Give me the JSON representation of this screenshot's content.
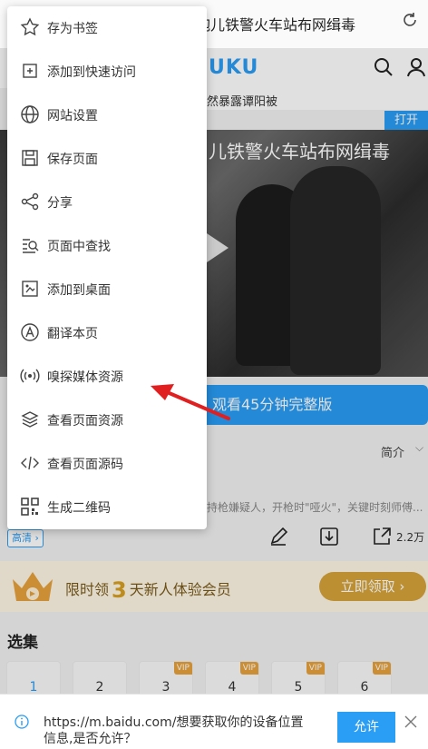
{
  "browser": {
    "page_title": "老炮儿铁警火车站布网缉毒",
    "refresh_icon": "refresh-icon"
  },
  "site": {
    "logo": "UKU",
    "marquee": "然暴露谭阳被",
    "open_label": "打开",
    "video_title": "儿铁警火车站布网缉毒",
    "watch_label": "观看45分钟完整版",
    "intro_label": "简介",
    "description": "持枪嫌疑人，开枪时\"哑火\"，关键时刻师傅...",
    "hd_label": "高清",
    "share_count": "2.2万",
    "vip_text_pre": "限时领",
    "vip_days": "3",
    "vip_text_post": "天新人体验会员",
    "vip_button": "立即领取",
    "episodes_title": "选集",
    "episodes": [
      {
        "num": "1",
        "vip": ""
      },
      {
        "num": "2",
        "vip": ""
      },
      {
        "num": "3",
        "vip": "VIP"
      },
      {
        "num": "4",
        "vip": "VIP"
      },
      {
        "num": "5",
        "vip": "VIP"
      },
      {
        "num": "6",
        "vip": "VIP"
      }
    ]
  },
  "menu": {
    "items": [
      {
        "label": "存为书签",
        "icon": "star-icon"
      },
      {
        "label": "添加到快速访问",
        "icon": "quick-access-icon"
      },
      {
        "label": "网站设置",
        "icon": "globe-icon"
      },
      {
        "label": "保存页面",
        "icon": "save-icon"
      },
      {
        "label": "分享",
        "icon": "share-icon"
      },
      {
        "label": "页面中查找",
        "icon": "find-in-page-icon"
      },
      {
        "label": "添加到桌面",
        "icon": "add-to-desktop-icon"
      },
      {
        "label": "翻译本页",
        "icon": "translate-icon"
      },
      {
        "label": "嗅探媒体资源",
        "icon": "media-sniff-icon"
      },
      {
        "label": "查看页面资源",
        "icon": "layers-icon"
      },
      {
        "label": "查看页面源码",
        "icon": "code-icon"
      },
      {
        "label": "生成二维码",
        "icon": "qr-code-icon"
      }
    ]
  },
  "permission": {
    "message": "https://m.baidu.com/想要获取你的设备位置信息,是否允许？",
    "allow_label": "允许"
  },
  "colors": {
    "accent": "#2a9df4",
    "gold": "#d7a43a",
    "arrow": "#e02020"
  }
}
